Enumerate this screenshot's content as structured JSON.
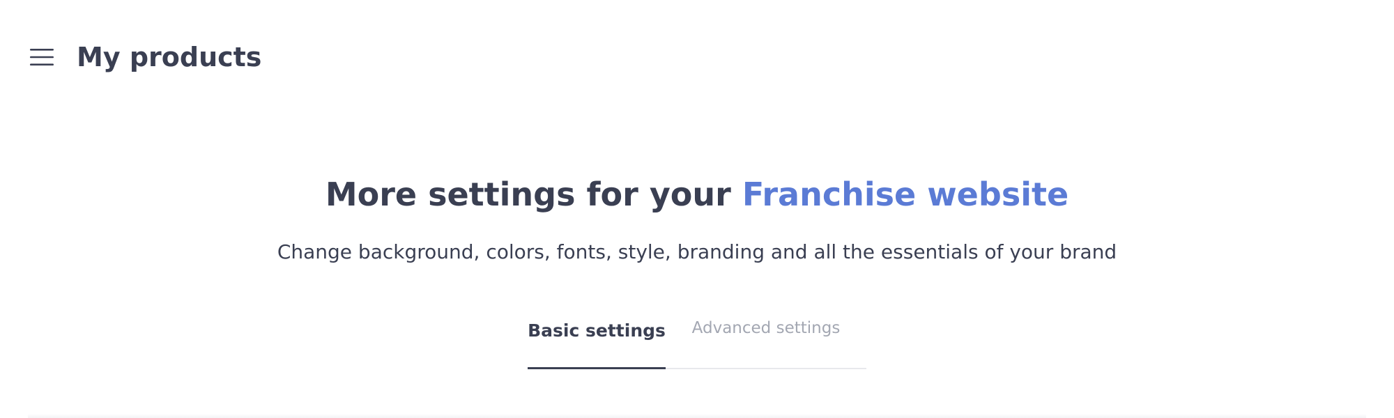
{
  "header": {
    "menu_icon": "hamburger-menu-icon",
    "title": "My products"
  },
  "hero": {
    "title_prefix": "More settings for your ",
    "title_accent": "Franchise website",
    "subtitle": "Change background, colors, fonts, style, branding and all the essentials of your brand"
  },
  "tabs": [
    {
      "label": "Basic settings",
      "active": true
    },
    {
      "label": "Advanced settings",
      "active": false
    }
  ],
  "colors": {
    "text": "#3a3f52",
    "accent": "#5b7bd5",
    "inactive_tab": "#a3a7b2",
    "divider": "#e7e8ec",
    "background": "#ffffff"
  }
}
